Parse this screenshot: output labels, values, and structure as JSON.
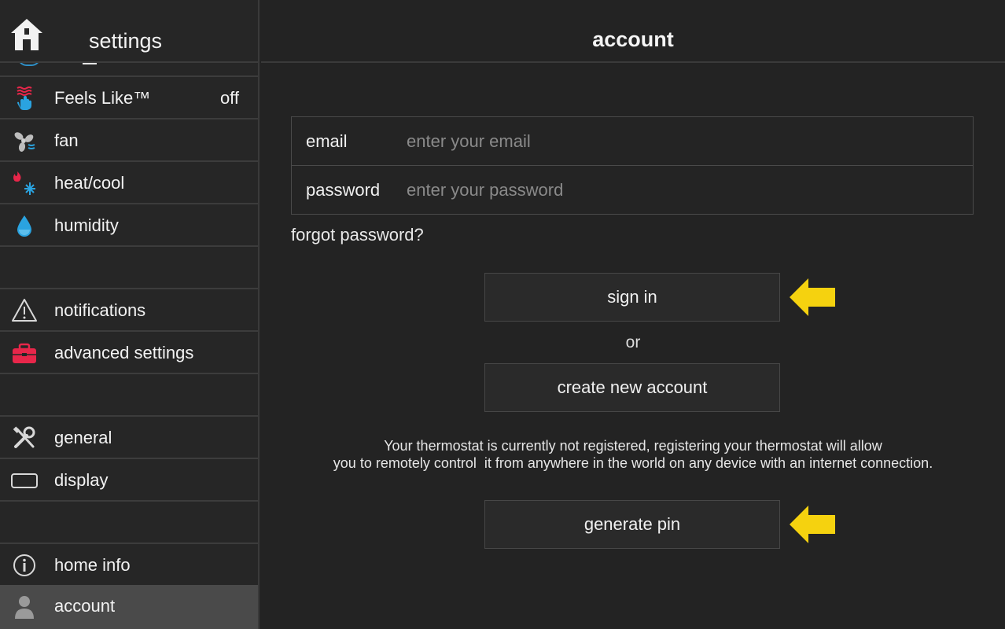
{
  "sidebar": {
    "title": "settings",
    "items": [
      {
        "name": "feels-like",
        "label": "Feels Like™",
        "value": "off",
        "icon": "feels-like-icon"
      },
      {
        "name": "fan",
        "label": "fan",
        "icon": "fan-icon"
      },
      {
        "name": "heat-cool",
        "label": "heat/cool",
        "icon": "heat-cool-icon"
      },
      {
        "name": "humidity",
        "label": "humidity",
        "icon": "droplet-icon"
      },
      {
        "name": "notifications",
        "label": "notifications",
        "icon": "warning-icon"
      },
      {
        "name": "advanced-settings",
        "label": "advanced settings",
        "icon": "toolbox-icon"
      },
      {
        "name": "general",
        "label": "general",
        "icon": "tools-icon"
      },
      {
        "name": "display",
        "label": "display",
        "icon": "display-icon"
      },
      {
        "name": "home-info",
        "label": "home info",
        "icon": "info-icon"
      },
      {
        "name": "account",
        "label": "account",
        "icon": "user-icon",
        "active": true
      }
    ]
  },
  "main": {
    "title": "account",
    "email": {
      "label": "email",
      "placeholder": "enter your email",
      "value": ""
    },
    "password": {
      "label": "password",
      "placeholder": "enter your password",
      "value": ""
    },
    "forgot_label": "forgot password?",
    "sign_in_label": "sign in",
    "or_label": "or",
    "create_label": "create new account",
    "info_line1": "Your thermostat is currently not registered, registering your thermostat will allow",
    "info_line2": "you to remotely control  it from anywhere in the world on any device with an internet connection.",
    "generate_pin_label": "generate pin"
  },
  "colors": {
    "background": "#232323",
    "active_item": "#4a4a4a",
    "arrow": "#f5d20f",
    "heat": "#e8264a",
    "cool": "#2aa3e0",
    "toolbox": "#e8264a"
  }
}
